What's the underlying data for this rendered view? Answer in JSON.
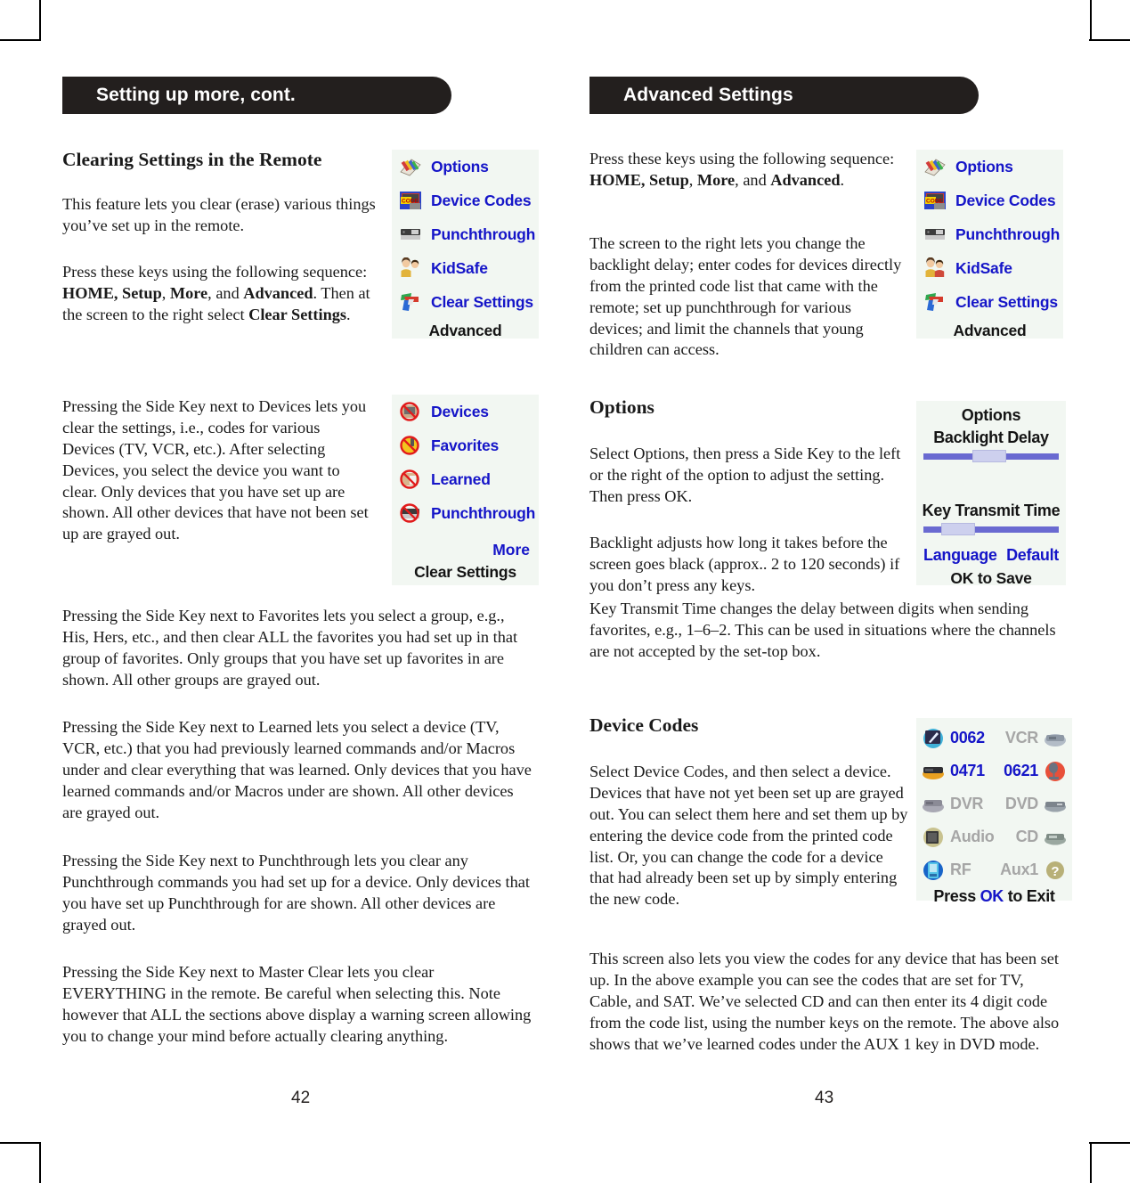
{
  "document": {
    "left_page_number": "42",
    "right_page_number": "43"
  },
  "left_page": {
    "banner": "Setting up more, cont.",
    "heading": "Clearing Settings in the Remote",
    "paragraphs": {
      "intro": "This feature lets you clear (erase) various things you’ve set up in the remote.",
      "sequence_pre": "Press these keys using the following sequence: ",
      "sequence_bold1": "HOME, Setup",
      "sequence_mid1": ", ",
      "sequence_bold2": "More",
      "sequence_mid2": ", and ",
      "sequence_bold3": "Advanced",
      "sequence_post": ". Then at the screen to the right select ",
      "sequence_bold4": "Clear Settings",
      "sequence_end": ".",
      "devices": "Pressing the Side Key next to Devices lets you clear the settings, i.e., codes for various Devices (TV, VCR, etc.). After selecting Devices, you select the device you want to clear. Only devices that you have set up are shown. All other devices that have not been set up are grayed out.",
      "favorites": "Pressing the Side Key next to Favorites lets you select a group, e.g., His, Hers, etc., and then clear ALL the favorites you had set up in that group of favorites. Only groups that you have set up favorites in are shown. All other groups are grayed out.",
      "learned": "Pressing the Side Key next to Learned lets you select a device (TV, VCR, etc.) that you had previously learned commands and/or Macros under and clear everything that was learned. Only devices that you have learned commands and/or Macros under are shown. All other devices are grayed out.",
      "punchthrough": "Pressing the Side Key next to Punchthrough lets you clear any Punchthrough commands you had set up for a device. Only devices that you have set up Punchthrough for are shown. All other devices are grayed out.",
      "master_clear": "Pressing the Side Key next to Master Clear lets you clear EVERYTHING in the remote. Be careful when selecting this. Note however that ALL the sections above display a warning screen allowing you to change your mind before actually clearing anything."
    },
    "screen_advanced": {
      "items": [
        {
          "label": "Options",
          "icon": "options-icon",
          "enabled": true
        },
        {
          "label": "Device Codes",
          "icon": "device-codes-icon",
          "enabled": true
        },
        {
          "label": "Punchthrough",
          "icon": "punchthrough-icon",
          "enabled": true
        },
        {
          "label": "KidSafe",
          "icon": "kidsafe-icon",
          "enabled": true
        },
        {
          "label": "Clear Settings",
          "icon": "clear-settings-icon",
          "enabled": true
        }
      ],
      "footer": "Advanced"
    },
    "screen_clear_settings": {
      "items": [
        {
          "label": "Devices",
          "icon": "no-devices-icon",
          "enabled": true
        },
        {
          "label": "Favorites",
          "icon": "no-favorites-icon",
          "enabled": true
        },
        {
          "label": "Learned",
          "icon": "no-learned-icon",
          "enabled": true
        },
        {
          "label": "Punchthrough",
          "icon": "no-punchthrough-icon",
          "enabled": true
        }
      ],
      "more_label": "More",
      "footer": "Clear Settings"
    }
  },
  "right_page": {
    "banner": "Advanced Settings",
    "paragraphs": {
      "sequence_pre": "Press these keys using the following sequence: ",
      "sequence_bold1": "HOME, Setup",
      "sequence_mid1": ", ",
      "sequence_bold2": "More",
      "sequence_mid2": ", and ",
      "sequence_bold3": "Advanced",
      "sequence_end": ".",
      "screen_desc": "The screen to the right lets you change the backlight delay; enter codes for devices directly from the printed code list that came with the remote; set up punchthrough for various devices; and limit the channels that young children can access.",
      "options_select": "Select Options, then press a Side Key to the left or the right of the option to adjust the setting. Then press OK.",
      "backlight": "Backlight adjusts how long it takes before the screen goes black (approx.. 2 to 120 seconds) if you don’t press any keys.",
      "key_transmit": "Key Transmit Time changes the delay between digits when sending favorites, e.g., 1–6–2. This can be used in situations where the channels are not accepted by the set-top box.",
      "device_codes_select": "Select Device Codes, and then select a device. Devices that have not yet been set up are grayed out. You can select them here and set them up by entering the device code from the printed code list. Or, you can change the code for a device that had already been set up by simply entering the new code.",
      "device_codes_view": "This screen also lets you view the codes for any device that has been set up. In the above example you can see the codes that are set for TV, Cable, and SAT. We’ve selected CD and can then enter its 4 digit code from the code list, using the number keys on the remote. The above also shows that we’ve learned codes under the AUX 1 key in DVD mode."
    },
    "headings": {
      "options": "Options",
      "device_codes": "Device Codes"
    },
    "screen_advanced": {
      "items": [
        {
          "label": "Options",
          "icon": "options-icon",
          "enabled": true
        },
        {
          "label": "Device Codes",
          "icon": "device-codes-icon",
          "enabled": true
        },
        {
          "label": "Punchthrough",
          "icon": "punchthrough-icon",
          "enabled": true
        },
        {
          "label": "KidSafe",
          "icon": "kidsafe-icon",
          "enabled": true
        },
        {
          "label": "Clear Settings",
          "icon": "clear-settings-icon",
          "enabled": true
        }
      ],
      "footer": "Advanced"
    },
    "screen_options": {
      "title": "Options",
      "backlight_label": "Backlight Delay",
      "backlight_value_pct": 38,
      "key_transmit_label": "Key Transmit Time",
      "key_transmit_value_pct": 15,
      "language_label": "Language",
      "default_label": "Default",
      "footer": "OK to Save"
    },
    "screen_device_codes": {
      "rows": [
        {
          "left_icon": "tv-icon",
          "left_text": "0062",
          "left_enabled": true,
          "right_text": "VCR",
          "right_icon": "vcr-icon",
          "right_enabled": false
        },
        {
          "left_icon": "cable-icon",
          "left_text": "0471",
          "left_enabled": true,
          "right_text": "0621",
          "right_icon": "sat-icon",
          "right_enabled": true
        },
        {
          "left_icon": "dvr-icon",
          "left_text": "DVR",
          "left_enabled": false,
          "right_text": "DVD",
          "right_icon": "dvd-icon",
          "right_enabled": false
        },
        {
          "left_icon": "audio-icon",
          "left_text": "Audio",
          "left_enabled": false,
          "right_text": "CD",
          "right_icon": "cd-icon",
          "right_enabled": false
        },
        {
          "left_icon": "rf-icon",
          "left_text": "RF",
          "left_enabled": false,
          "right_text": "Aux1",
          "right_icon": "aux-help-icon",
          "right_enabled": false
        }
      ],
      "footer_pre": "Press ",
      "footer_ok": "OK",
      "footer_post": " to Exit"
    }
  },
  "colors": {
    "banner_bg": "#231f1e",
    "lcd_bg": "#f2f7f2",
    "lcd_link": "#1515c8",
    "lcd_dim": "#a0a0a0",
    "slider_track": "#6a6ad1",
    "slider_thumb": "#cdd0ee"
  }
}
